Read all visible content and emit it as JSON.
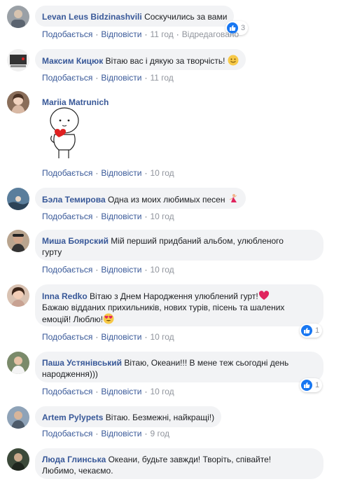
{
  "actions": {
    "like": "Подобається",
    "reply": "Відповісти",
    "separator": "·"
  },
  "comments": [
    {
      "author": "Levan Leus Bidzinashvili",
      "text": "Соскучились за вами",
      "time": "11 год",
      "edited": "Відредаговано",
      "reactions": "3"
    },
    {
      "author": "Максим Кицюк",
      "text": "Вітаю вас і дякую за творчість!",
      "time": "11 год"
    },
    {
      "author": "Mariia Matrunich",
      "text": "",
      "time": "10 год"
    },
    {
      "author": "Бэла Темирова",
      "text": "Одна из моих любимых песен",
      "time": "10 год"
    },
    {
      "author": "Миша Боярский",
      "text": "Мій перший придбаний альбом, улюбленого",
      "text2": "гурту",
      "time": "10 год"
    },
    {
      "author": "Inna Redko",
      "text": "Вітаю з Днем Народження улюблений гурт!",
      "text2": "Бажаю відданих прихильників, нових турів, пісень та шалених",
      "text3": "емоцій! Люблю!",
      "time": "10 год",
      "reactions": "1"
    },
    {
      "author": "Паша Устянівський",
      "text": "Вітаю, Океани!!! В мене теж сьогодні день",
      "text2": "народження)))",
      "time": "10 год",
      "reactions": "1"
    },
    {
      "author": "Artem Pylypets",
      "text": "Вітаю. Безмежні, найкращі!)",
      "time": "9 год"
    },
    {
      "author": "Люда Глинська",
      "text": "Океани, будьте завжди! Творіть, співайте!",
      "text2": "Любимо, чекаємо."
    }
  ],
  "colors": {
    "author": "#385898",
    "bubble": "#f2f3f5",
    "like": "#1877f2",
    "meta": "#90949c"
  }
}
